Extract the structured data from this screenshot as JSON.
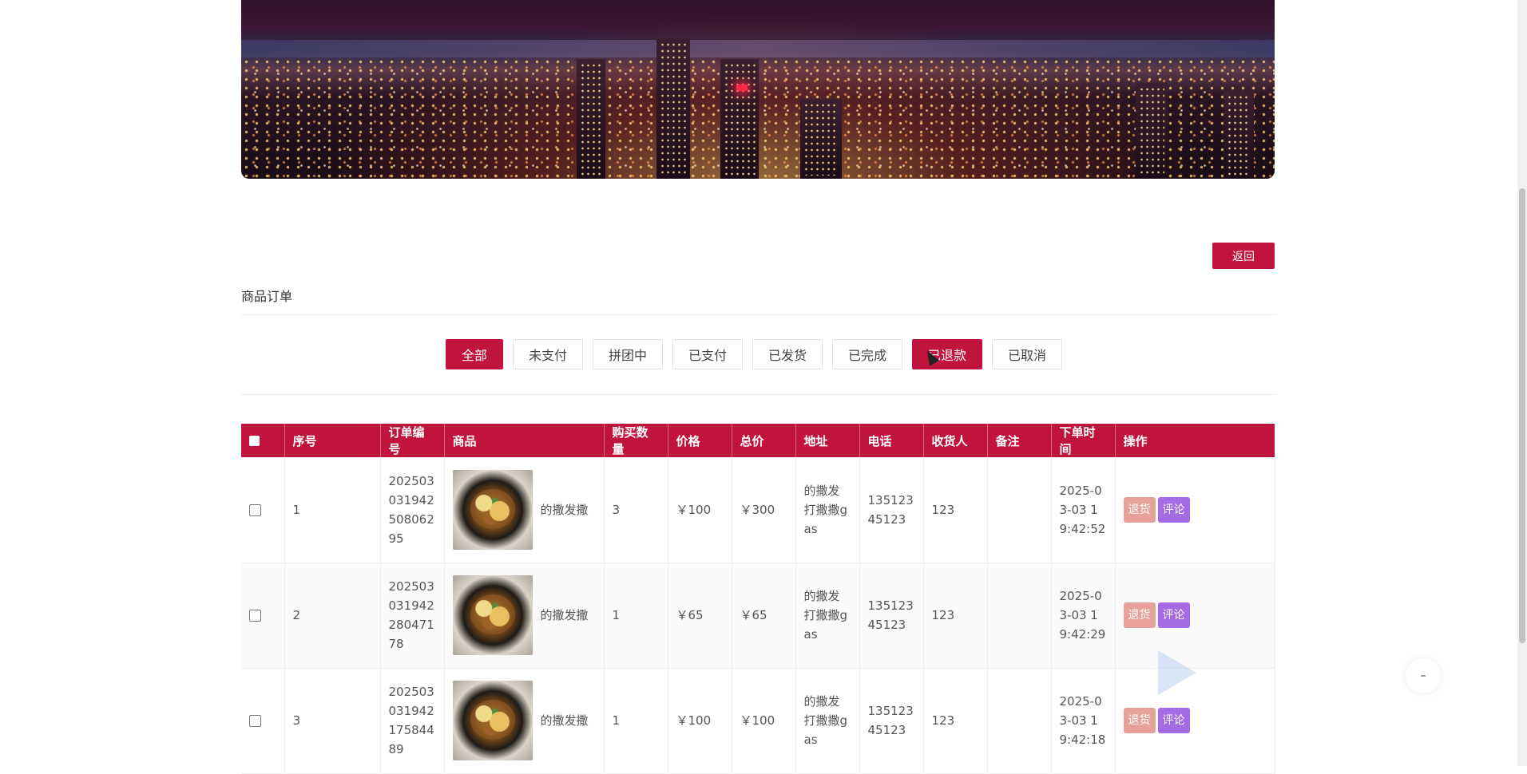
{
  "header": {
    "back_label": "返回"
  },
  "section": {
    "title": "商品订单"
  },
  "tabs": [
    {
      "label": "全部",
      "active": true
    },
    {
      "label": "未支付"
    },
    {
      "label": "拼团中"
    },
    {
      "label": "已支付"
    },
    {
      "label": "已发货"
    },
    {
      "label": "已完成"
    },
    {
      "label": "已退款",
      "active": true
    },
    {
      "label": "已取消"
    }
  ],
  "table": {
    "columns": [
      "序号",
      "订单编号",
      "商品",
      "购买数量",
      "价格",
      "总价",
      "地址",
      "电话",
      "收货人",
      "备注",
      "下单时间",
      "操作"
    ],
    "rows": [
      {
        "index": "1",
        "order_no": "20250303194250806295",
        "product": "的撒发撒",
        "qty": "3",
        "price": "￥100",
        "total": "￥300",
        "address": "的撒发打撒撒gas",
        "phone": "13512345123",
        "receiver": "123",
        "note": "",
        "time": "2025-03-03 19:42:52"
      },
      {
        "index": "2",
        "order_no": "20250303194228047178",
        "product": "的撒发撒",
        "qty": "1",
        "price": "￥65",
        "total": "￥65",
        "address": "的撒发打撒撒gas",
        "phone": "13512345123",
        "receiver": "123",
        "note": "",
        "time": "2025-03-03 19:42:29"
      },
      {
        "index": "3",
        "order_no": "20250303194217584489",
        "product": "的撒发撒",
        "qty": "1",
        "price": "￥100",
        "total": "￥100",
        "address": "的撒发打撒撒gas",
        "phone": "13512345123",
        "receiver": "123",
        "note": "",
        "time": "2025-03-03 19:42:18"
      }
    ],
    "actions": {
      "refund": "退货",
      "review": "评论"
    }
  },
  "colors": {
    "accent": "#c0143c",
    "refund_btn": "#e8a19a",
    "review_btn": "#a56be6"
  }
}
